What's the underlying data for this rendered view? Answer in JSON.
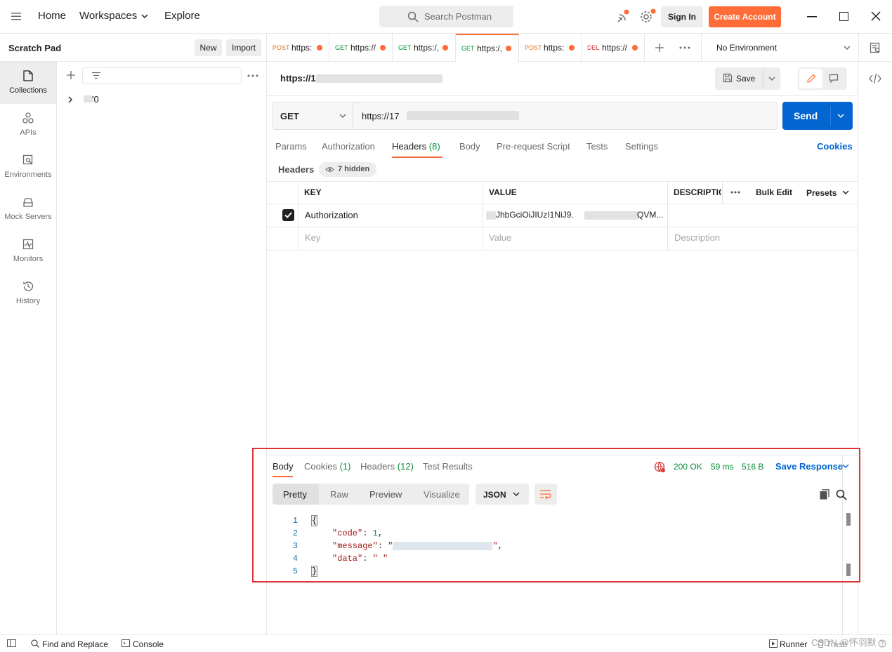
{
  "topbar": {
    "nav": [
      "Home",
      "Workspaces",
      "Explore"
    ],
    "search_placeholder": "Search Postman",
    "sign_in": "Sign In",
    "create_account": "Create Account"
  },
  "leftpane": {
    "title": "Scratch Pad",
    "new": "New",
    "import": "Import",
    "tree_item": "'0"
  },
  "sidebar": {
    "items": [
      {
        "label": "Collections",
        "icon": "collections-icon"
      },
      {
        "label": "APIs",
        "icon": "apis-icon"
      },
      {
        "label": "Environments",
        "icon": "environments-icon"
      },
      {
        "label": "Mock Servers",
        "icon": "mock-servers-icon"
      },
      {
        "label": "Monitors",
        "icon": "monitors-icon"
      },
      {
        "label": "History",
        "icon": "history-icon"
      }
    ]
  },
  "tabs": [
    {
      "method": "POST",
      "url": "https:"
    },
    {
      "method": "GET",
      "url": "https://"
    },
    {
      "method": "GET",
      "url": "https:/,"
    },
    {
      "method": "GET",
      "url": "https:/,"
    },
    {
      "method": "POST",
      "url": "https:"
    },
    {
      "method": "DEL",
      "url": "https://"
    }
  ],
  "environment": "No Environment",
  "request": {
    "title": "https://1",
    "save": "Save",
    "method": "GET",
    "url": "https://17",
    "send": "Send",
    "tabs": [
      "Params",
      "Authorization",
      "Headers",
      "(8)",
      "Body",
      "Pre-request Script",
      "Tests",
      "Settings"
    ],
    "cookies": "Cookies",
    "headers_label": "Headers",
    "hidden": "7 hidden",
    "table": {
      "columns": [
        "KEY",
        "VALUE",
        "DESCRIPTIO"
      ],
      "bulk_edit": "Bulk Edit",
      "presets": "Presets",
      "rows": [
        {
          "key": "Authorization",
          "value": "JhbGciOiJIUzI1NiJ9.",
          "value_tail": "QVM...",
          "checked": true
        }
      ],
      "placeholders": {
        "key": "Key",
        "value": "Value",
        "description": "Description"
      }
    }
  },
  "response": {
    "tabs": [
      "Body",
      "Cookies",
      "(1)",
      "Headers",
      "(12)",
      "Test Results"
    ],
    "status": "200 OK",
    "time": "59 ms",
    "size": "516 B",
    "save_response": "Save Response",
    "views": [
      "Pretty",
      "Raw",
      "Preview",
      "Visualize"
    ],
    "format": "JSON",
    "line_numbers": [
      "1",
      "2",
      "3",
      "4",
      "5"
    ],
    "code": {
      "open": "{",
      "k1": "\"code\"",
      "v1": "1",
      "k2": "\"message\"",
      "v2": "\"",
      "k3": "\"data\"",
      "v3": "\" \"",
      "close": "}"
    }
  },
  "bottombar": {
    "find": "Find and Replace",
    "console": "Console",
    "runner": "Runner",
    "trash": "Trash",
    "watermark": "CSDN @怀羽默"
  },
  "colors": {
    "accent": "#ff6c37",
    "send": "#0265d2",
    "highlight": "#e03436",
    "status_ok": "#0a8f3c"
  }
}
